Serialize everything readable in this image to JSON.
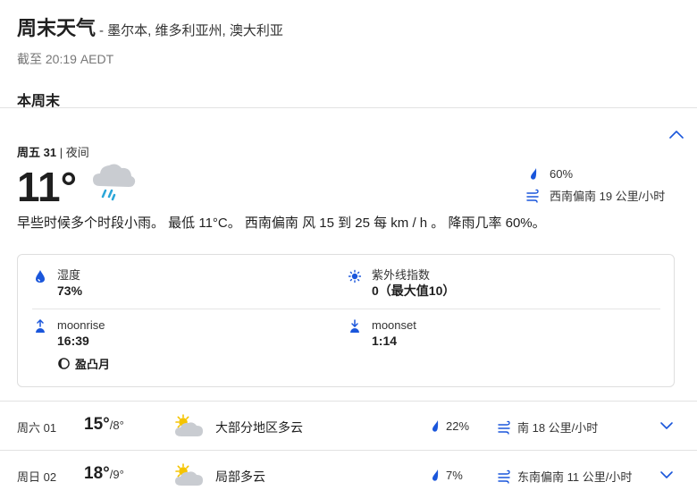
{
  "header": {
    "title": "周末天气",
    "location": "- 墨尔本, 维多利亚州, 澳大利亚",
    "updated": "截至 20:19 AEDT"
  },
  "section": {
    "title": "本周末"
  },
  "current": {
    "day": "周五 31",
    "period": "| 夜间",
    "temperature": "11°",
    "precip_chance": "60%",
    "wind": "西南偏南 19 公里/小时",
    "summary": "早些时候多个时段小雨。 最低 11°C。 西南偏南 风 15 到 25 每 km / h 。 降雨几率 60%。",
    "icon": "cloud-rain-icon"
  },
  "details": {
    "humidity_label": "湿度",
    "humidity_value": "73%",
    "uv_label": "紫外线指数",
    "uv_value": "0（最大值10）",
    "moonrise_label": "moonrise",
    "moonrise_value": "16:39",
    "moonset_label": "moonset",
    "moonset_value": "1:14",
    "moon_phase": "盈凸月"
  },
  "forecast": [
    {
      "day": "周六 01",
      "high": "15°",
      "low": "/8°",
      "condition": "大部分地区多云",
      "precip": "22%",
      "wind": "南 18 公里/小时",
      "icon": "partly-cloudy-icon"
    },
    {
      "day": "周日 02",
      "high": "18°",
      "low": "/9°",
      "condition": "局部多云",
      "precip": "7%",
      "wind": "东南偏南 11 公里/小时",
      "icon": "partly-cloudy-icon"
    }
  ],
  "colors": {
    "accent": "#1a56db",
    "divider": "#e2e2e2",
    "sun": "#f5c400"
  }
}
